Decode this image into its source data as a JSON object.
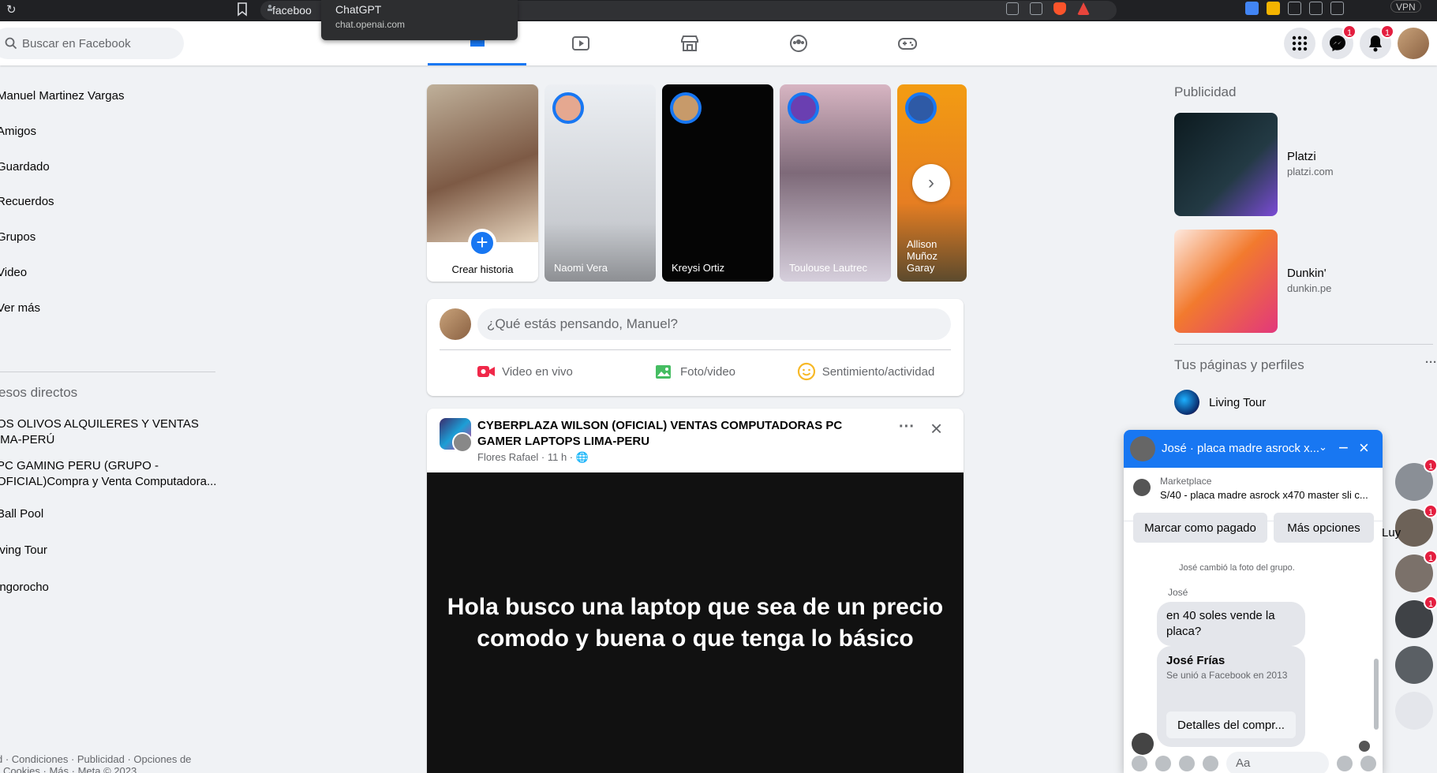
{
  "browser": {
    "url_text": "faceboo",
    "vpn_label": "VPN",
    "tooltip": {
      "title": "ChatGPT",
      "subtitle": "chat.openai.com"
    }
  },
  "topbar": {
    "search_placeholder": "Buscar en Facebook",
    "tabs": [
      "home-icon",
      "video-icon",
      "marketplace-icon",
      "groups-icon",
      "gaming-icon"
    ],
    "messenger_badge": "1",
    "notifications_badge": "1"
  },
  "left": {
    "items": [
      "Manuel Martinez Vargas",
      "Amigos",
      "Guardado",
      "Recuerdos",
      "Grupos",
      "Video",
      "Ver más"
    ],
    "shortcuts_heading": "esos directos",
    "shortcuts": [
      "OS OLIVOS ALQUILERES Y VENTAS\nIMA-PERÚ",
      "PC GAMING PERU (GRUPO -\nOFICIAL)Compra y Venta Computadora...",
      "Ball Pool",
      "iving Tour",
      "ingorocho"
    ],
    "footer": "d · Condiciones · Publicidad · Opciones de\n· Cookies · Más · Meta © 2023"
  },
  "stories": {
    "create_label": "Crear historia",
    "items": [
      {
        "name": "Naomi Vera"
      },
      {
        "name": "Kreysi Ortiz"
      },
      {
        "name": "Toulouse Lautrec"
      },
      {
        "name": "Allison Muñoz\nGaray"
      }
    ]
  },
  "composer": {
    "placeholder": "¿Qué estás pensando, Manuel?",
    "live_label": "Video en vivo",
    "photo_label": "Foto/video",
    "feeling_label": "Sentimiento/actividad"
  },
  "post": {
    "group": "CYBERPLAZA WILSON (OFICIAL) VENTAS COMPUTADORAS PC GAMER LAPTOPS LIMA-PERU",
    "author": "Flores Rafael · 11 h · ",
    "text": "Hola busco una laptop que sea de un precio comodo y buena o que tenga lo básico"
  },
  "right": {
    "ads_heading": "Publicidad",
    "ads": [
      {
        "name": "Platzi",
        "domain": "platzi.com"
      },
      {
        "name": "Dunkin'",
        "domain": "dunkin.pe"
      }
    ],
    "pages_heading": "Tus páginas y perfiles",
    "pages": [
      {
        "name": "Living Tour"
      }
    ]
  },
  "chat": {
    "title": "José · placa madre asrock x...",
    "marketplace_label": "Marketplace",
    "listing": "S/40 - placa madre asrock x470 master sli c...",
    "mark_paid": "Marcar como pagado",
    "more_options": "Más opciones",
    "system_note": "José cambió la foto del grupo.",
    "sender": "José",
    "message": "en 40 soles vende la placa?",
    "card_name": "José Frías",
    "card_sub": "Se unió a Facebook en 2013",
    "card_button": "Detalles del compr...",
    "input_placeholder": "Aa"
  },
  "chat_heads": {
    "badges": [
      "1",
      "1",
      "1",
      "1"
    ],
    "partial_name": "Luy"
  }
}
